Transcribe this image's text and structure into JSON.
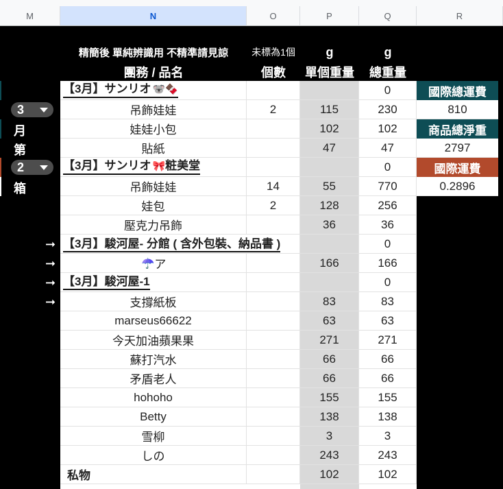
{
  "columns": [
    "M",
    "N",
    "O",
    "P",
    "Q",
    "R"
  ],
  "headers": {
    "note": "精簡後 單純辨識用 不精準請見諒",
    "name": "團務 / 品名",
    "qty_note": "未標為1個",
    "qty": "個數",
    "unit_g": "g",
    "unit_weight": "單個重量",
    "total_g": "g",
    "total_weight": "總重量"
  },
  "rows": [
    {
      "type": "group",
      "name": "【3月】サンリオ",
      "emoji": "🐨🍫",
      "qty": "",
      "unit": "",
      "total": "0"
    },
    {
      "type": "item",
      "name": "吊飾娃娃",
      "qty": "2",
      "unit": "115",
      "total": "230"
    },
    {
      "type": "item",
      "name": "娃娃小包",
      "qty": "",
      "unit": "102",
      "total": "102"
    },
    {
      "type": "item",
      "name": "貼紙",
      "qty": "",
      "unit": "47",
      "total": "47"
    },
    {
      "type": "group",
      "name": "【3月】サンリオ",
      "emoji": "🎀",
      "suffix": "粧美堂",
      "qty": "",
      "unit": "",
      "total": "0"
    },
    {
      "type": "item",
      "name": "吊飾娃娃",
      "qty": "14",
      "unit": "55",
      "total": "770"
    },
    {
      "type": "item",
      "name": "娃包",
      "qty": "2",
      "unit": "128",
      "total": "256"
    },
    {
      "type": "item",
      "name": "壓克力吊飾",
      "qty": "",
      "unit": "36",
      "total": "36"
    },
    {
      "type": "group",
      "name": "【3月】駿河屋- 分館 ( 含外包裝、納品書 )",
      "qty": "",
      "unit": "",
      "total": "0"
    },
    {
      "type": "item",
      "name": "ア",
      "emoji": "☂️",
      "qty": "",
      "unit": "166",
      "total": "166"
    },
    {
      "type": "group",
      "name": "【3月】駿河屋-1",
      "qty": "",
      "unit": "",
      "total": "0"
    },
    {
      "type": "item",
      "name": "支撐紙板",
      "qty": "",
      "unit": "83",
      "total": "83"
    },
    {
      "type": "item",
      "name": "marseus66622",
      "qty": "",
      "unit": "63",
      "total": "63"
    },
    {
      "type": "item",
      "name": "今天加油蘋果果",
      "qty": "",
      "unit": "271",
      "total": "271"
    },
    {
      "type": "item",
      "name": "蘇打汽水",
      "qty": "",
      "unit": "66",
      "total": "66"
    },
    {
      "type": "item",
      "name": "矛盾老人",
      "qty": "",
      "unit": "66",
      "total": "66"
    },
    {
      "type": "item",
      "name": "hohoho",
      "qty": "",
      "unit": "155",
      "total": "155"
    },
    {
      "type": "item",
      "name": "Betty",
      "qty": "",
      "unit": "138",
      "total": "138"
    },
    {
      "type": "item",
      "name": "雪柳",
      "qty": "",
      "unit": "3",
      "total": "3"
    },
    {
      "type": "item",
      "name": "しの",
      "qty": "",
      "unit": "243",
      "total": "243"
    },
    {
      "type": "left",
      "name": "私物",
      "qty": "",
      "unit": "102",
      "total": "102"
    }
  ],
  "left_panel": {
    "month_value": "3",
    "month_label": "月",
    "di_label": "第",
    "box_value": "2",
    "box_label": "箱",
    "arrow": "➞"
  },
  "right_panel": {
    "intl_total_label": "國際總運費",
    "intl_total_value": "810",
    "net_weight_label": "商品總淨重",
    "net_weight_value": "2797",
    "intl_rate_label": "國際運費",
    "intl_rate_value": "0.2896"
  },
  "colors": {
    "teal": "#0e4d55",
    "rust": "#b24a2c",
    "gray_col": "#d9d9d9",
    "selected_header": "#d3e3fd"
  }
}
